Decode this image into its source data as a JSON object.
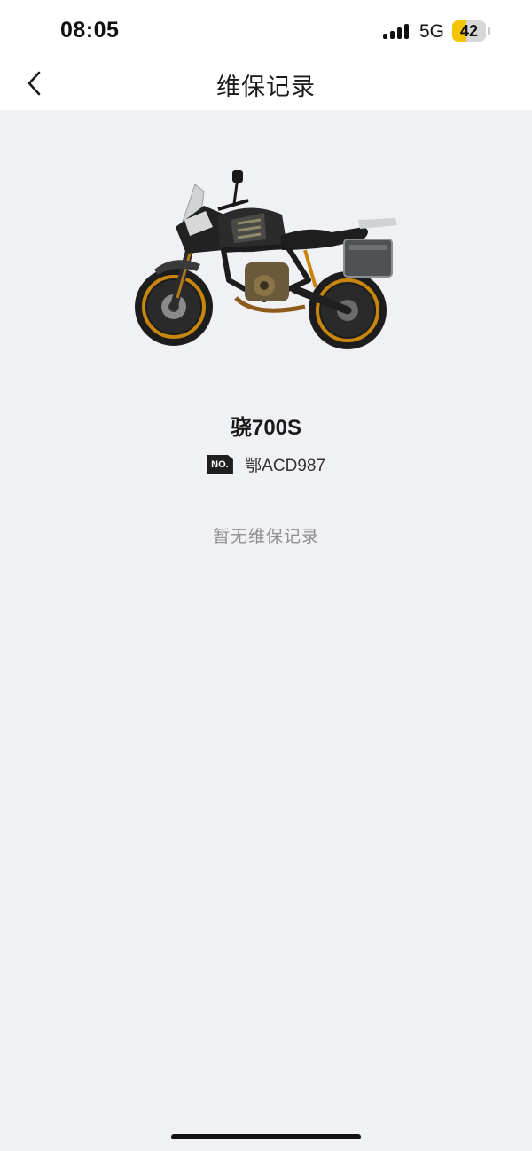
{
  "status_bar": {
    "time": "08:05",
    "network": "5G",
    "battery": "42",
    "battery_level": 0.42,
    "battery_color": "#f5c400",
    "signal_icon": "signal-bars-icon"
  },
  "nav": {
    "back_icon": "chevron-left-icon",
    "title": "维保记录"
  },
  "vehicle": {
    "image_icon": "motorcycle-image",
    "name": "骁700S",
    "plate_badge": "NO.",
    "plate_number": "鄂ACD987"
  },
  "records": {
    "empty_message": "暂无维保记录"
  }
}
